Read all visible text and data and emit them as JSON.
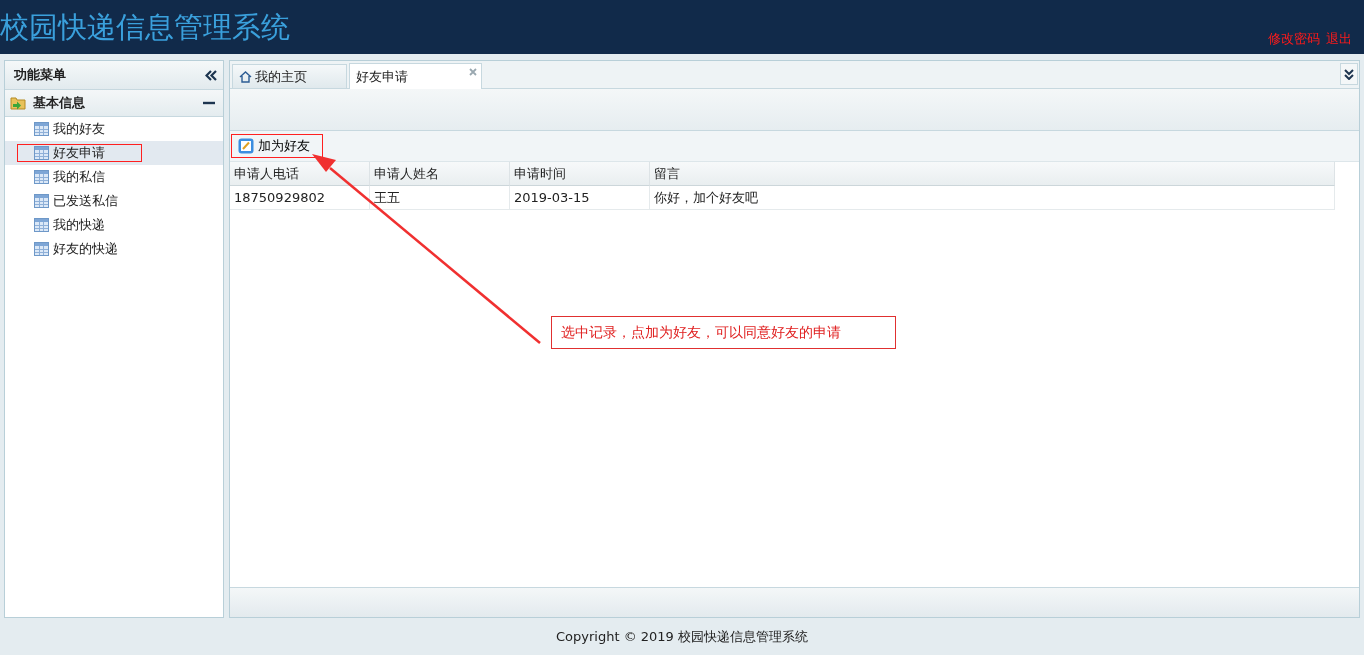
{
  "header": {
    "title": "校园快递信息管理系统",
    "links": [
      "修改密码",
      "退出"
    ]
  },
  "sidebar": {
    "title": "功能菜单",
    "group": {
      "label": "基本信息",
      "expanded": true,
      "items": [
        {
          "label": "我的好友",
          "selected": false,
          "annotated": false
        },
        {
          "label": "好友申请",
          "selected": true,
          "annotated": true
        },
        {
          "label": "我的私信",
          "selected": false,
          "annotated": false
        },
        {
          "label": "已发送私信",
          "selected": false,
          "annotated": false
        },
        {
          "label": "我的快递",
          "selected": false,
          "annotated": false
        },
        {
          "label": "好友的快递",
          "selected": false,
          "annotated": false
        }
      ]
    }
  },
  "tabs": [
    {
      "label": "我的主页",
      "selected": false,
      "kind": "home"
    },
    {
      "label": "好友申请",
      "selected": true,
      "kind": "closable"
    }
  ],
  "toolbar": {
    "button": "加为好友",
    "annotated": true
  },
  "table": {
    "columns": [
      "申请人电话",
      "申请人姓名",
      "申请时间",
      "留言"
    ],
    "rows": [
      [
        "18750929802",
        "王五",
        "2019-03-15",
        "你好，加个好友吧"
      ]
    ]
  },
  "callout": "选中记录，点加为好友，可以同意好友的申请",
  "footer": "Copyright © 2019 校园快递信息管理系统"
}
